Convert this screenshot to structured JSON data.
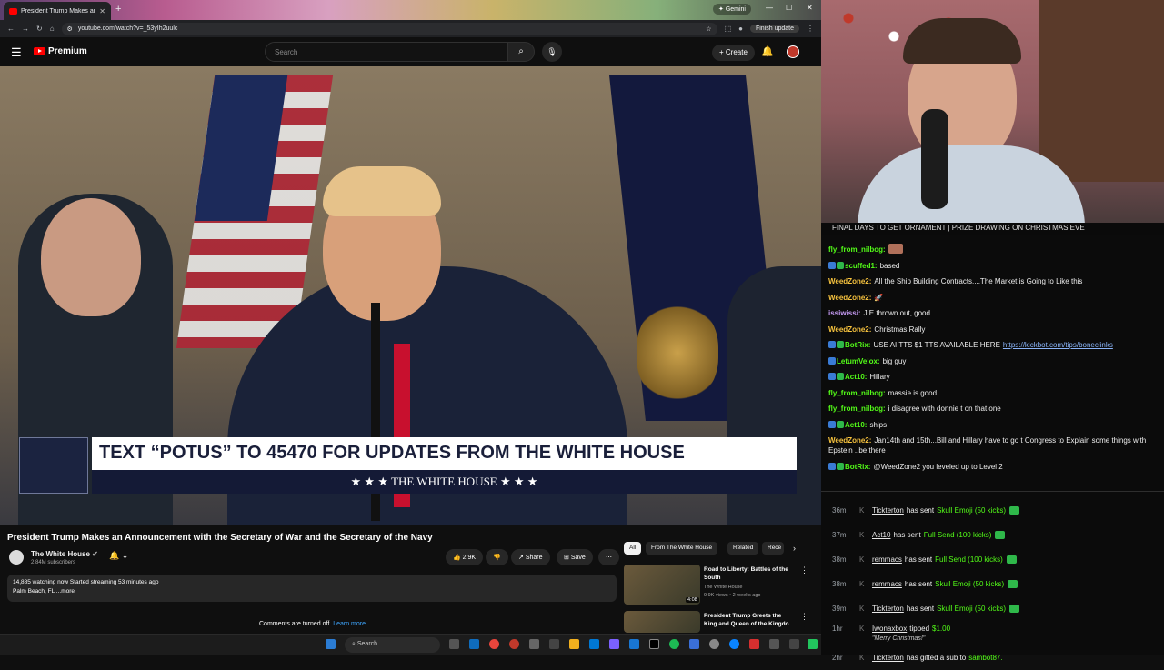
{
  "browser": {
    "tab_title": "President Trump Makes an",
    "url": "youtube.com/watch?v=_53yIh2uulc",
    "gemini_label": "Gemini",
    "finish_update_label": "Finish update"
  },
  "youtube": {
    "logo_text": "Premium",
    "search_placeholder": "Search",
    "create_label": "Create"
  },
  "video": {
    "banner_text": "TEXT “POTUS” TO 45470 FOR UPDATES FROM THE WHITE HOUSE",
    "banner_sub": "★ ★ ★  THE WHITE HOUSE  ★ ★ ★",
    "title": "President Trump Makes an Announcement with the Secretary of War and the Secretary of the Navy",
    "channel_name": "The White House",
    "channel_subs": "2.84M subscribers",
    "likes": "2.9K",
    "share_label": "Share",
    "save_label": "Save",
    "description_line1": "14,885 watching now  Started streaming 53 minutes ago",
    "description_line2": "Palm Beach, FL ...more",
    "comments_off": "Comments are turned off.",
    "learn_more": "Learn more"
  },
  "recommendations": {
    "chips": [
      "All",
      "From The White House",
      "Related",
      "Rece"
    ],
    "items": [
      {
        "title": "Road to Liberty: Battles of the South",
        "channel": "The White House",
        "meta": "9.9K views • 2 weeks ago",
        "duration": "4:08"
      },
      {
        "title": "President Trump Greets the King and Queen of the Kingdo...",
        "channel": "",
        "meta": "",
        "duration": ""
      }
    ]
  },
  "taskbar": {
    "search_label": "Search"
  },
  "stream": {
    "ticker": "FINAL DAYS TO GET ORNAMENT | PRIZE DRAWING ON CHRISTMAS EVE",
    "chat": [
      {
        "user": "fly_from_nilbog:",
        "text": "",
        "color": "#53fc18",
        "badges": 0,
        "emote": true
      },
      {
        "user": "scuffed1:",
        "text": "based",
        "color": "#53fc18",
        "badges": 2
      },
      {
        "user": "WeedZone2:",
        "text": "All the Ship Building Contracts....The Market is Going to Like this",
        "color": "#f6c23e",
        "badges": 0
      },
      {
        "user": "WeedZone2:",
        "text": "🚀",
        "color": "#f6c23e",
        "badges": 0
      },
      {
        "user": "issiwissi:",
        "text": "J.E thrown out, good",
        "color": "#c79cf5",
        "badges": 0
      },
      {
        "user": "WeedZone2:",
        "text": "Christmas Rally",
        "color": "#f6c23e",
        "badges": 0
      },
      {
        "user": "BotRix:",
        "text": "USE AI TTS $1 TTS AVAILABLE HERE",
        "link": "https://kickbot.com/tips/boneclinks",
        "color": "#53fc18",
        "badges": 2
      },
      {
        "user": "LetumVelox:",
        "text": "big guy",
        "color": "#53fc18",
        "badges": 1
      },
      {
        "user": "Act10:",
        "text": "Hillary",
        "color": "#53fc18",
        "badges": 2
      },
      {
        "user": "fly_from_nilbog:",
        "text": "massie is good",
        "color": "#53fc18",
        "badges": 0
      },
      {
        "user": "fly_from_nilbog:",
        "text": "i disagree with donnie t on that one",
        "color": "#53fc18",
        "badges": 0
      },
      {
        "user": "Act10:",
        "text": "ships",
        "color": "#53fc18",
        "badges": 2
      },
      {
        "user": "WeedZone2:",
        "text": "Jan14th and 15th...Bill and Hillary have to go t Congress to Explain some things with Epstein ..be there",
        "color": "#f6c23e",
        "badges": 0
      },
      {
        "user": "BotRix:",
        "text": "@WeedZone2 you leveled up to Level 2",
        "color": "#53fc18",
        "badges": 2
      }
    ],
    "events": [
      {
        "time": "36m",
        "user": "Tickterton",
        "verb": "has sent",
        "item": "Skull Emoji (50 kicks)"
      },
      {
        "time": "37m",
        "user": "Act10",
        "verb": "has sent",
        "item": "Full Send (100 kicks)"
      },
      {
        "time": "38m",
        "user": "remmacs",
        "verb": "has sent",
        "item": "Full Send (100 kicks)"
      },
      {
        "time": "38m",
        "user": "remmacs",
        "verb": "has sent",
        "item": "Skull Emoji (50 kicks)"
      },
      {
        "time": "39m",
        "user": "Tickterton",
        "verb": "has sent",
        "item": "Skull Emoji (50 kicks)"
      },
      {
        "time": "1hr",
        "user": "Iwonaxbox",
        "verb": "tipped",
        "item": "$1.00",
        "note": "\"Merry Christmas!\""
      },
      {
        "time": "2hr",
        "user": "Tickterton",
        "verb": "has gifted a sub to",
        "item": "sambot87."
      }
    ]
  }
}
